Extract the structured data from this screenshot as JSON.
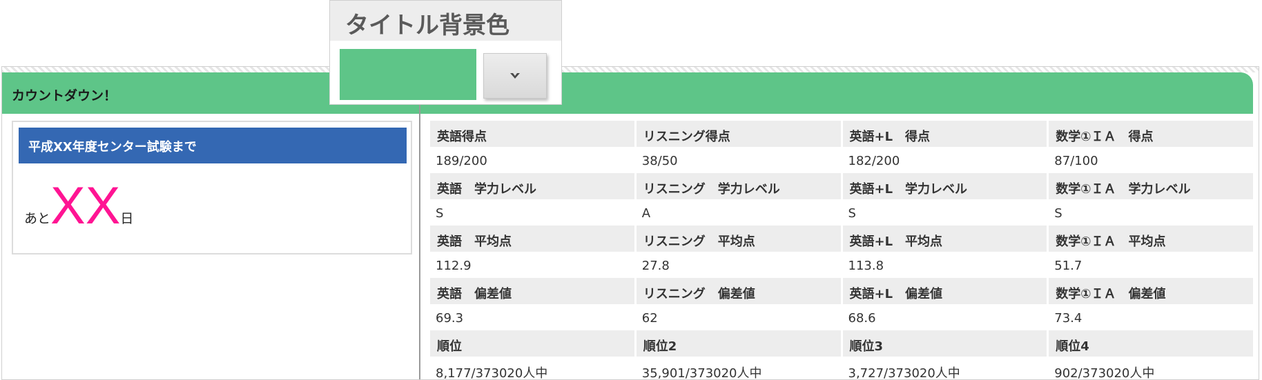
{
  "colors": {
    "header_green": "#5ec588",
    "countdown_blue": "#3468b3",
    "countdown_pink": "#ff1493",
    "label_gray": "#ededed"
  },
  "panel": {
    "title": "カウントダウン！"
  },
  "countdown": {
    "heading": "平成XX年度センター試験まで",
    "prefix": "あと",
    "number": "XX",
    "suffix": "日"
  },
  "picker": {
    "title": "タイトル背景色",
    "swatch_color": "#5ec588",
    "button_icon": "chevron-down-icon"
  },
  "grid": {
    "rows": [
      {
        "labels": [
          "英語得点",
          "リスニング得点",
          "英語+L　得点",
          "数学①ＩＡ　得点"
        ],
        "values": [
          "189/200",
          "38/50",
          "182/200",
          "87/100"
        ]
      },
      {
        "labels": [
          "英語　学力レベル",
          "リスニング　学力レベル",
          "英語+L　学力レベル",
          "数学①ＩＡ　学力レベル"
        ],
        "values": [
          "S",
          "A",
          "S",
          "S"
        ]
      },
      {
        "labels": [
          "英語　平均点",
          "リスニング　平均点",
          "英語+L　平均点",
          "数学①ＩＡ　平均点"
        ],
        "values": [
          "112.9",
          "27.8",
          "113.8",
          "51.7"
        ]
      },
      {
        "labels": [
          "英語　偏差値",
          "リスニング　偏差値",
          "英語+L　偏差値",
          "数学①ＩＡ　偏差値"
        ],
        "values": [
          "69.3",
          "62",
          "68.6",
          "73.4"
        ]
      },
      {
        "labels": [
          "順位",
          "順位2",
          "順位3",
          "順位4"
        ],
        "values": [
          "8,177/373020人中",
          "35,901/373020人中",
          "3,727/373020人中",
          "902/373020人中"
        ]
      }
    ]
  }
}
